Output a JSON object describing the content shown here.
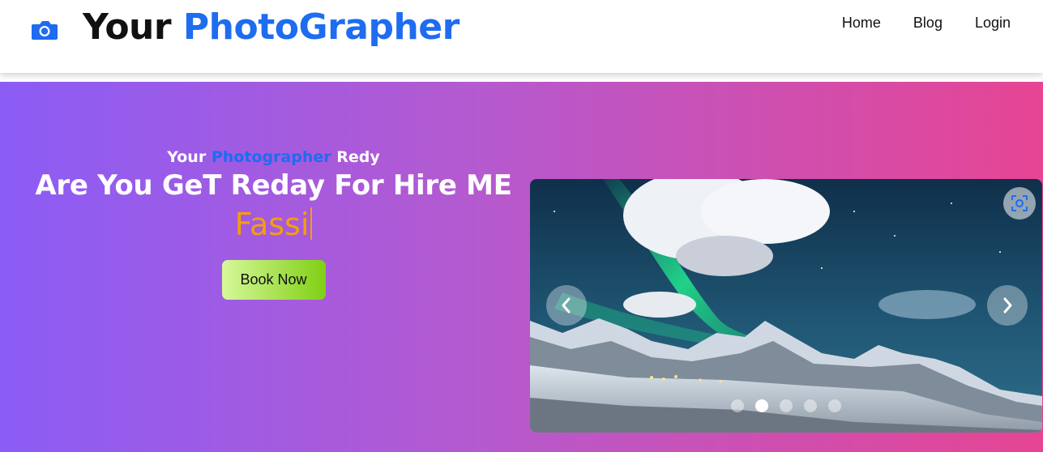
{
  "header": {
    "logo_icon": "camera-icon",
    "brand_prefix": "Your",
    "brand_accent": "PhotoGrapher",
    "accent_color": "#1e6cf0"
  },
  "nav": {
    "items": [
      {
        "label": "Home"
      },
      {
        "label": "Blog"
      },
      {
        "label": "Login"
      }
    ]
  },
  "hero": {
    "eyebrow_prefix": "Your",
    "eyebrow_accent": "Photographer",
    "eyebrow_suffix": "Redy",
    "headline": "Are You GeT Reday For Hire ME",
    "typed_text": "Fassi",
    "book_button": "Book Now",
    "gradient": [
      "#8b5cf6",
      "#e64593"
    ],
    "typed_color": "#f59e0b"
  },
  "carousel": {
    "prev_icon": "chevron-left-icon",
    "next_icon": "chevron-right-icon",
    "corner_icon": "screenshot-scan-icon",
    "slide_count": 5,
    "active_index": 1
  }
}
